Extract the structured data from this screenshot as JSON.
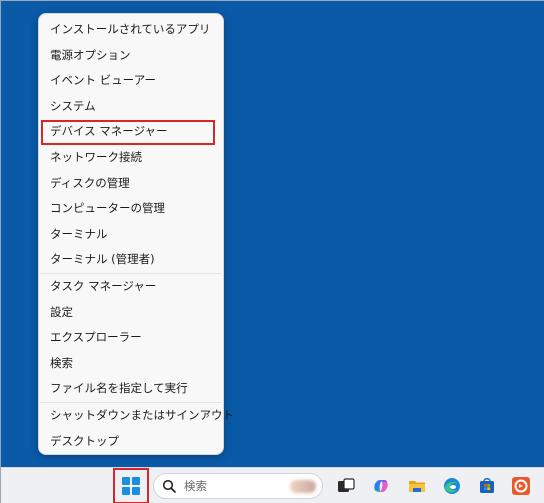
{
  "menu": {
    "items": [
      {
        "label": "インストールされているアプリ"
      },
      {
        "label": "電源オプション"
      },
      {
        "label": "イベント ビューアー"
      },
      {
        "label": "システム"
      },
      {
        "label": "デバイス マネージャー",
        "highlighted": true
      },
      {
        "label": "ネットワーク接続"
      },
      {
        "label": "ディスクの管理"
      },
      {
        "label": "コンピューターの管理"
      },
      {
        "label": "ターミナル"
      },
      {
        "label": "ターミナル (管理者)"
      },
      {
        "label": "タスク マネージャー"
      },
      {
        "label": "設定"
      },
      {
        "label": "エクスプローラー"
      },
      {
        "label": "検索"
      },
      {
        "label": "ファイル名を指定して実行"
      },
      {
        "label": "シャットダウンまたはサインアウト",
        "submenu": true
      },
      {
        "label": "デスクトップ"
      }
    ]
  },
  "taskbar": {
    "search_placeholder": "検索",
    "icons": [
      "task-view-icon",
      "copilot-icon",
      "file-explorer-icon",
      "edge-icon",
      "microsoft-store-icon",
      "office-icon"
    ]
  },
  "colors": {
    "desktop": "#0a5aa8",
    "highlight_border": "#d9262b",
    "menu_bg": "#f8f8f8",
    "taskbar_bg": "#eef0f4"
  }
}
